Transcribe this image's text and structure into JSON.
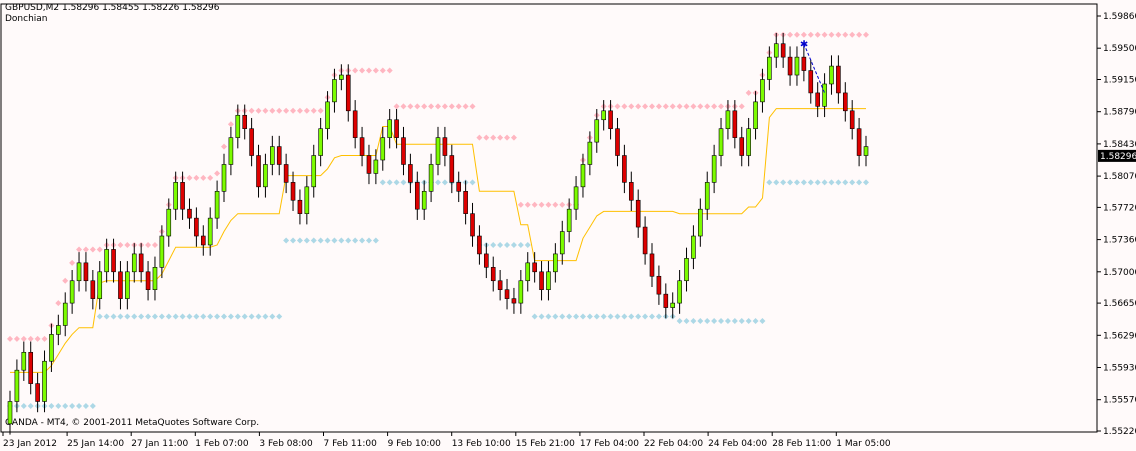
{
  "header": {
    "symbol_line": "GBPUSD,M2  1.58296 1.58455 1.58226 1.58296",
    "indicator_name": "Donchian"
  },
  "footer": {
    "copyright": "OANDA - MT4, © 2001-2011 MetaQuotes Software Corp."
  },
  "colors": {
    "background": "#fffafa",
    "bull_candle": "#7cfc00",
    "bear_candle": "#dd0000",
    "wick": "#000000",
    "donchian_upper": "#ffb6c1",
    "donchian_lower": "#add8e6",
    "middle_line": "#ffc000",
    "price_label_bg": "#000000",
    "price_label_fg": "#ffffff",
    "arrow": "#0000cc"
  },
  "chart_data": {
    "type": "candlestick",
    "symbol": "GBPUSD",
    "timeframe": "M2",
    "ylim": [
      1.5522,
      1.5986
    ],
    "y_ticks": [
      1.5986,
      1.595,
      1.5915,
      1.5879,
      1.5843,
      1.5807,
      1.5772,
      1.5736,
      1.57,
      1.5665,
      1.5629,
      1.5593,
      1.5557,
      1.5522
    ],
    "x_ticks": [
      "23 Jan 2012",
      "25 Jan 14:00",
      "27 Jan 11:00",
      "1 Feb 07:00",
      "3 Feb 08:00",
      "7 Feb 11:00",
      "9 Feb 10:00",
      "13 Feb 10:00",
      "15 Feb 21:00",
      "17 Feb 04:00",
      "22 Feb 04:00",
      "24 Feb 04:00",
      "28 Feb 11:00",
      "1 Mar 05:00"
    ],
    "current_price": "1.58296",
    "closes": [
      1.5555,
      1.559,
      1.561,
      1.5575,
      1.5555,
      1.56,
      1.563,
      1.564,
      1.5665,
      1.569,
      1.571,
      1.569,
      1.567,
      1.57,
      1.5725,
      1.57,
      1.567,
      1.57,
      1.572,
      1.57,
      1.568,
      1.5705,
      1.574,
      1.577,
      1.58,
      1.577,
      1.576,
      1.574,
      1.573,
      1.576,
      1.579,
      1.582,
      1.585,
      1.5875,
      1.586,
      1.583,
      1.5795,
      1.582,
      1.584,
      1.582,
      1.58,
      1.578,
      1.5765,
      1.5795,
      1.583,
      1.586,
      1.589,
      1.5915,
      1.592,
      1.588,
      1.585,
      1.583,
      1.581,
      1.5825,
      1.585,
      1.587,
      1.585,
      1.582,
      1.58,
      1.577,
      1.579,
      1.582,
      1.585,
      1.583,
      1.58,
      1.579,
      1.5765,
      1.574,
      1.572,
      1.5705,
      1.569,
      1.568,
      1.567,
      1.5665,
      1.569,
      1.571,
      1.57,
      1.568,
      1.57,
      1.572,
      1.5745,
      1.577,
      1.5795,
      1.582,
      1.5845,
      1.587,
      1.588,
      1.586,
      1.583,
      1.58,
      1.578,
      1.575,
      1.572,
      1.5695,
      1.5675,
      1.566,
      1.5665,
      1.569,
      1.5715,
      1.574,
      1.577,
      1.58,
      1.583,
      1.586,
      1.588,
      1.585,
      1.583,
      1.586,
      1.589,
      1.5915,
      1.594,
      1.5955,
      1.594,
      1.592,
      1.594,
      1.5925,
      1.59,
      1.5885,
      1.591,
      1.593,
      1.59,
      1.588,
      1.586,
      1.583,
      1.584
    ],
    "donchian_upper": [
      1.5625,
      1.5625,
      1.5625,
      1.5625,
      1.5625,
      1.5625,
      1.564,
      1.5665,
      1.569,
      1.571,
      1.5725,
      1.5725,
      1.5725,
      1.5725,
      1.573,
      1.573,
      1.573,
      1.573,
      1.573,
      1.573,
      1.573,
      1.573,
      1.5745,
      1.5775,
      1.5805,
      1.5805,
      1.5805,
      1.5805,
      1.5805,
      1.5805,
      1.581,
      1.584,
      1.5865,
      1.588,
      1.588,
      1.588,
      1.588,
      1.588,
      1.588,
      1.588,
      1.588,
      1.588,
      1.588,
      1.588,
      1.588,
      1.588,
      1.5895,
      1.592,
      1.5925,
      1.5925,
      1.5925,
      1.5925,
      1.5925,
      1.5925,
      1.5925,
      1.5925,
      1.5885,
      1.5885,
      1.5885,
      1.5885,
      1.5885,
      1.5885,
      1.5885,
      1.5885,
      1.5885,
      1.5885,
      1.5885,
      1.5885,
      1.585,
      1.585,
      1.585,
      1.585,
      1.585,
      1.585,
      1.5775,
      1.5775,
      1.5775,
      1.5775,
      1.5775,
      1.5775,
      1.5775,
      1.5775,
      1.5775,
      1.5825,
      1.585,
      1.5875,
      1.5885,
      1.5885,
      1.5885,
      1.5885,
      1.5885,
      1.5885,
      1.5885,
      1.5885,
      1.5885,
      1.5885,
      1.5885,
      1.5885,
      1.5885,
      1.5885,
      1.5885,
      1.5885,
      1.5885,
      1.5885,
      1.5885,
      1.5885,
      1.5885,
      1.59,
      1.59,
      1.592,
      1.5945,
      1.5965,
      1.5965,
      1.5965,
      1.5965,
      1.5965,
      1.5965,
      1.5965,
      1.5965,
      1.5965,
      1.5965,
      1.5965,
      1.5965,
      1.5965,
      1.5965
    ],
    "donchian_lower": [
      1.555,
      1.555,
      1.555,
      1.555,
      1.555,
      1.555,
      1.555,
      1.555,
      1.555,
      1.555,
      1.555,
      1.555,
      1.555,
      1.565,
      1.565,
      1.565,
      1.565,
      1.565,
      1.565,
      1.565,
      1.565,
      1.565,
      1.565,
      1.565,
      1.565,
      1.565,
      1.565,
      1.565,
      1.565,
      1.565,
      1.565,
      1.565,
      1.565,
      1.565,
      1.565,
      1.565,
      1.565,
      1.565,
      1.565,
      1.565,
      1.5735,
      1.5735,
      1.5735,
      1.5735,
      1.5735,
      1.5735,
      1.5735,
      1.5735,
      1.5735,
      1.5735,
      1.5735,
      1.5735,
      1.5735,
      1.5735,
      1.58,
      1.58,
      1.58,
      1.58,
      1.58,
      1.58,
      1.58,
      1.58,
      1.58,
      1.58,
      1.58,
      1.58,
      1.58,
      1.58,
      1.573,
      1.573,
      1.573,
      1.573,
      1.573,
      1.573,
      1.573,
      1.573,
      1.565,
      1.565,
      1.565,
      1.565,
      1.565,
      1.565,
      1.565,
      1.565,
      1.565,
      1.565,
      1.565,
      1.565,
      1.565,
      1.565,
      1.565,
      1.565,
      1.565,
      1.565,
      1.565,
      1.565,
      1.565,
      1.5645,
      1.5645,
      1.5645,
      1.5645,
      1.5645,
      1.5645,
      1.5645,
      1.5645,
      1.5645,
      1.5645,
      1.5645,
      1.5645,
      1.5645,
      1.58,
      1.58,
      1.58,
      1.58,
      1.58,
      1.58,
      1.58,
      1.58,
      1.58,
      1.58,
      1.58,
      1.58,
      1.58,
      1.58,
      1.58
    ]
  }
}
